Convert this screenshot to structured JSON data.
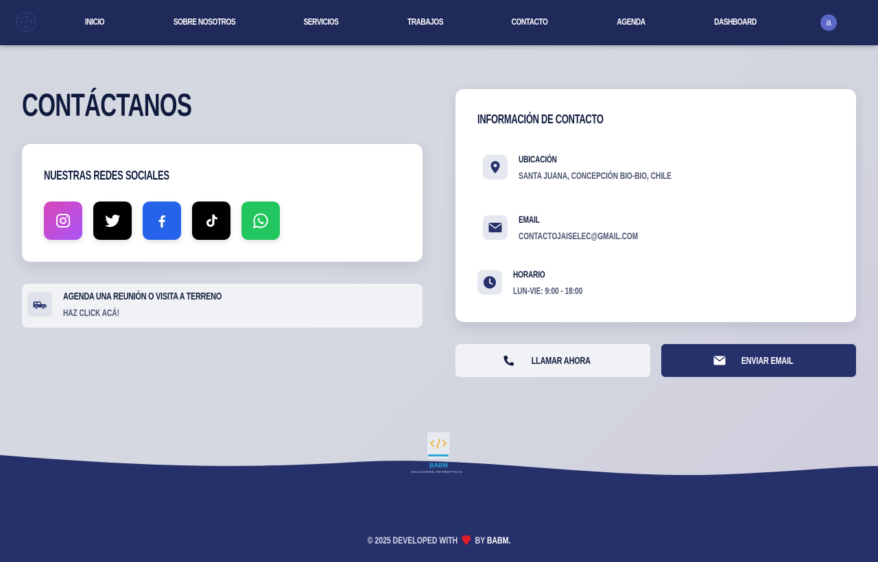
{
  "nav": {
    "items": [
      "INICIO",
      "SOBRE NOSOTROS",
      "SERVICIOS",
      "TRABAJOS",
      "CONTACTO",
      "AGENDA",
      "DASHBOARD"
    ],
    "avatar_initial": "a",
    "background": "#1f2a5b"
  },
  "page": {
    "title": "CONTÁCTANOS"
  },
  "social": {
    "title": "NUESTRAS REDES SOCIALES",
    "networks": [
      {
        "name": "instagram-icon",
        "color": "#c13584"
      },
      {
        "name": "twitter-icon",
        "color": "#000000"
      },
      {
        "name": "facebook-icon",
        "color": "#2563eb"
      },
      {
        "name": "tiktok-icon",
        "color": "#000000"
      },
      {
        "name": "whatsapp-icon",
        "color": "#22c55e"
      }
    ]
  },
  "agenda": {
    "title": "AGENDA UNA REUNIÓN O VISITA A TERRENO",
    "subtitle": "HAZ CLICK ACÁ!",
    "icon": "truck-icon"
  },
  "info": {
    "title": "INFORMACIÓN DE CONTACTO",
    "location": {
      "label": "UBICACIÓN",
      "value": "SANTA JUANA, CONCEPCIÓN BIO-BIO, CHILE",
      "icon": "map-pin-icon"
    },
    "email": {
      "label": "EMAIL",
      "value": "CONTACTOJAISELEC@GMAIL.COM",
      "icon": "envelope-icon"
    },
    "hours": {
      "label": "HORARIO",
      "value": "LUN-VIE: 9:00 - 18:00",
      "icon": "clock-icon"
    }
  },
  "actions": {
    "call_label": "LLAMAR AHORA",
    "email_label": "ENVIAR EMAIL"
  },
  "footer": {
    "logo_text": "BABM",
    "logo_subtext": "SOLUCIONES INFORMÁTICAS",
    "prefix": "© 2025 DEVELOPED WITH",
    "by": "BY",
    "brand": "BABM.",
    "background": "#26306b"
  },
  "colors": {
    "accent": "#26306b",
    "text_dark": "#0f1a3d"
  }
}
